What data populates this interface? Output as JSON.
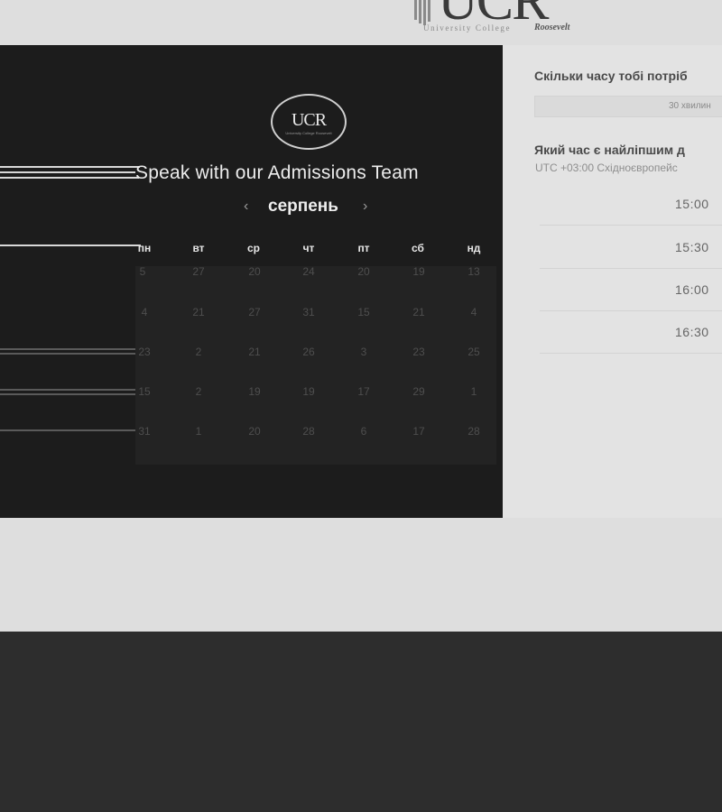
{
  "header": {
    "logo_letters": "UCR",
    "logo_sub1": "University College",
    "logo_sub2": "Roosevelt"
  },
  "calendar": {
    "logo_text": "UCR",
    "logo_tiny": "University College Roosevelt",
    "title": "Speak with our Admissions Team",
    "month": "серпень",
    "prev_icon": "‹",
    "next_icon": "›",
    "weekdays": [
      "пн",
      "вт",
      "ср",
      "чт",
      "пт",
      "сб",
      "нд"
    ],
    "weeks": [
      [
        "5",
        "27",
        "20",
        "24",
        "20",
        "19",
        "13"
      ],
      [
        "4",
        "21",
        "27",
        "31",
        "15",
        "21",
        "4"
      ],
      [
        "23",
        "2",
        "21",
        "26",
        "3",
        "23",
        "25"
      ],
      [
        "15",
        "2",
        "19",
        "19",
        "17",
        "29",
        "1"
      ],
      [
        "31",
        "1",
        "20",
        "28",
        "6",
        "17",
        "28"
      ]
    ]
  },
  "booking": {
    "duration_question": "Скільки часу тобі потріб",
    "duration_value": "30 хвилин",
    "time_question": "Який час є найліпшим д",
    "timezone": "UTC +03:00 Східноєвропейс",
    "slots": [
      "15:00",
      "15:30",
      "16:00",
      "16:30"
    ]
  },
  "colors": {
    "panel": "#1c1c1c",
    "page": "#dedede",
    "footer": "#2d2d2d"
  }
}
